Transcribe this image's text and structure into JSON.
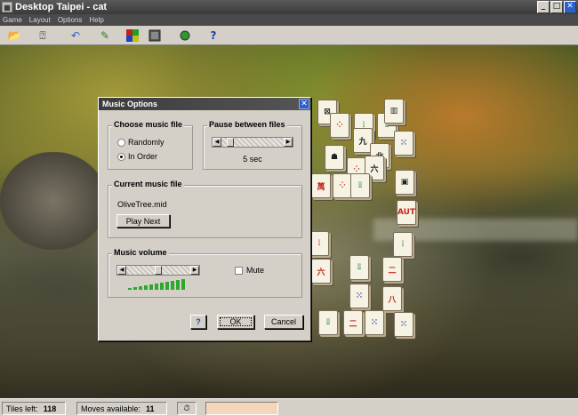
{
  "window": {
    "title": "Desktop Taipei - cat"
  },
  "menu": [
    "Game",
    "Layout",
    "Options",
    "Help"
  ],
  "toolbar": {
    "icons": [
      "open-icon",
      "hint-icon",
      "undo-icon",
      "wand-icon",
      "tiles-icon",
      "backgrounds-icon",
      "sound-icon",
      "help-icon"
    ],
    "help_glyph": "?"
  },
  "dialog": {
    "title": "Music Options",
    "choose_file": {
      "title": "Choose music file",
      "options": [
        "Randomly",
        "In Order"
      ],
      "selected": "In Order"
    },
    "pause": {
      "title": "Pause between files",
      "value": "5 sec",
      "level": 0.2
    },
    "current": {
      "title": "Current music file",
      "filename": "OliveTree.mid",
      "play_next": "Play Next"
    },
    "volume": {
      "title": "Music volume",
      "mute_label": "Mute",
      "muted": false,
      "level": 0.55
    },
    "buttons": {
      "help": "?",
      "ok": "OK",
      "cancel": "Cancel"
    }
  },
  "status": {
    "tiles_left_label": "Tiles left:",
    "tiles_left": "118",
    "moves_label": "Moves available:",
    "moves": "11"
  },
  "colors": {
    "dialog_bg": "#d4d0c8",
    "volume_bar": "#2ea82e",
    "status_highlight": "#f5d6b8"
  }
}
